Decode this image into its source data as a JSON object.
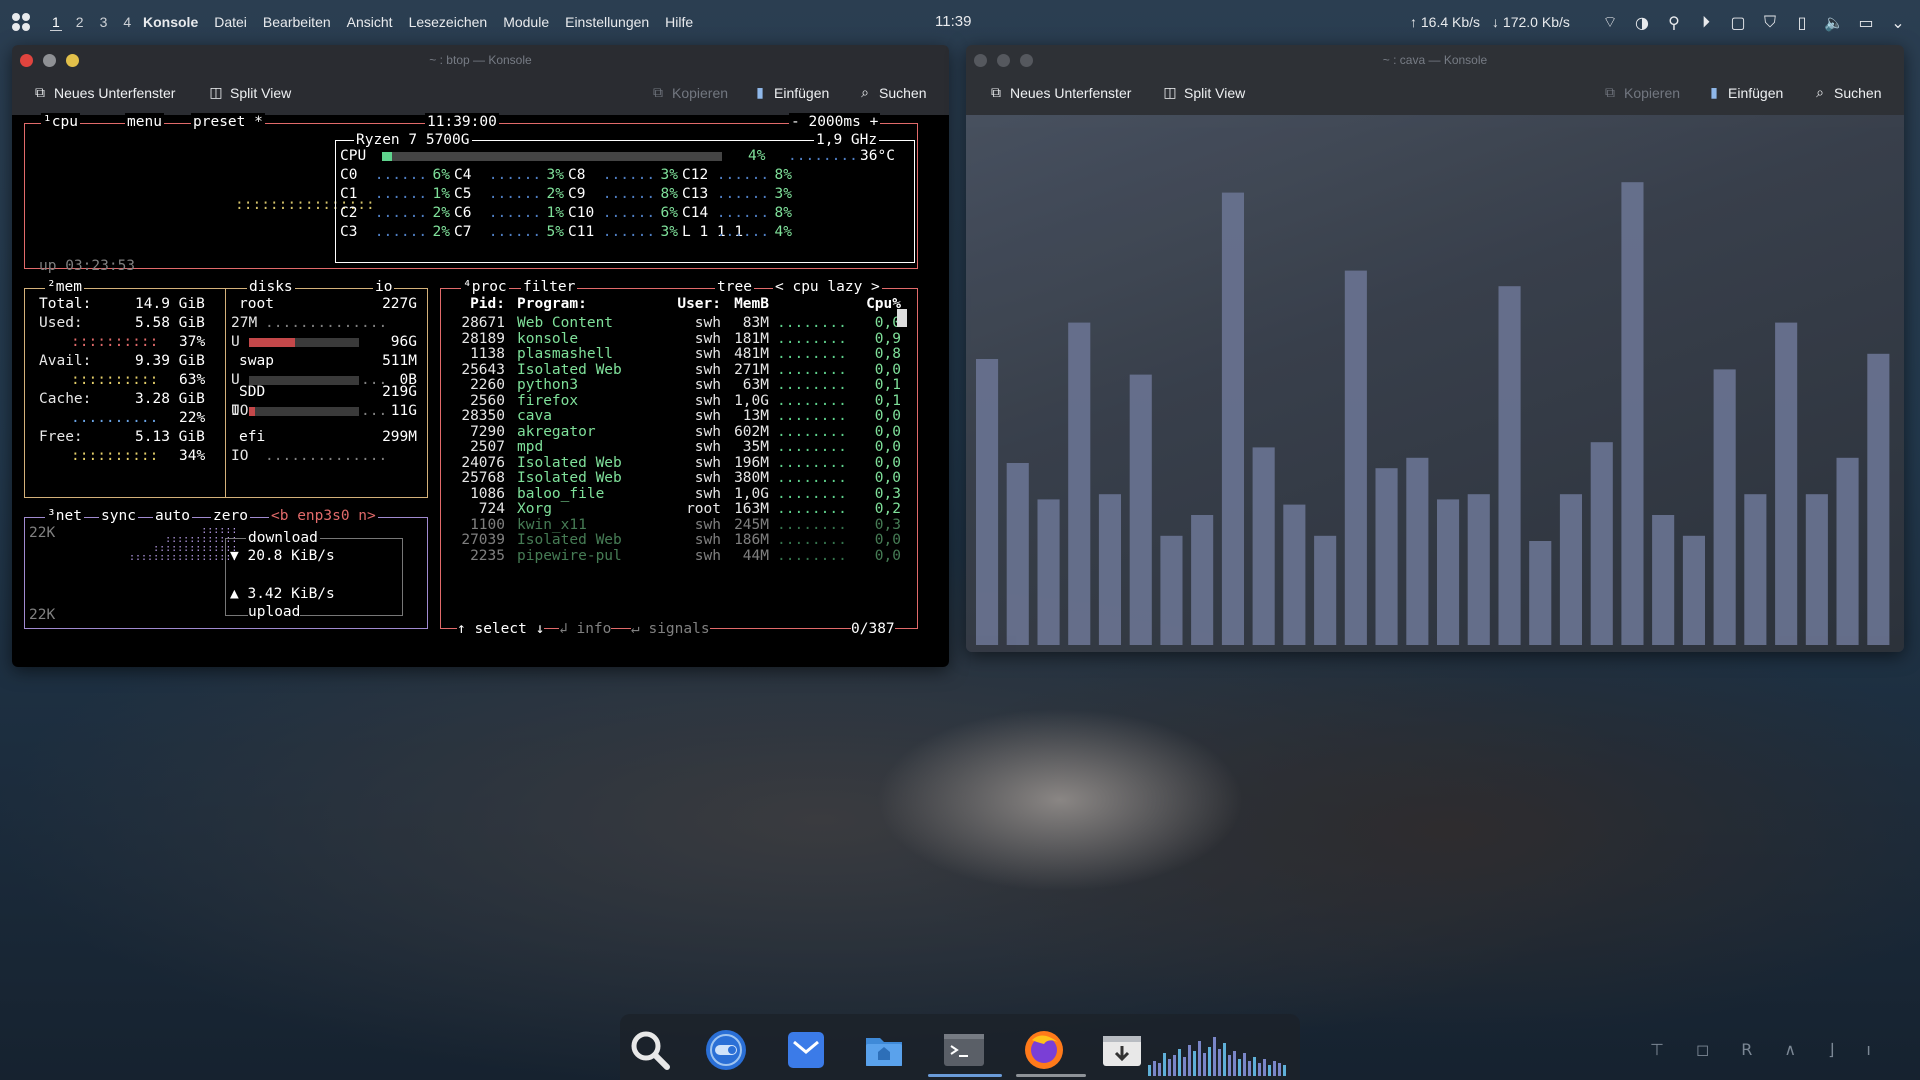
{
  "topbar": {
    "workspaces": [
      "1",
      "2",
      "3",
      "4"
    ],
    "app_name": "Konsole",
    "menu": [
      "Datei",
      "Bearbeiten",
      "Ansicht",
      "Lesezeichen",
      "Module",
      "Einstellungen",
      "Hilfe"
    ],
    "clock": "11:39",
    "net_up": "↑  16.4 Kb/s",
    "net_down": "↓ 172.0 Kb/s",
    "tray_icons": [
      "rss-icon",
      "night-mode-icon",
      "location-icon",
      "media-play-icon",
      "clipboard-icon",
      "shield-icon",
      "battery-icon",
      "volume-icon",
      "display-icon",
      "chevron-down-icon"
    ]
  },
  "btop_window": {
    "title": "~ : btop — Konsole",
    "toolbar": {
      "new_tab": "Neues Unterfenster",
      "split": "Split View",
      "copy": "Kopieren",
      "paste": "Einfügen",
      "search": "Suchen"
    },
    "cpu_box": {
      "tags": [
        "¹cpu",
        "menu",
        "preset *"
      ],
      "time": "11:39:00",
      "interval": "- 2000ms +",
      "model": "Ryzen 7 5700G",
      "freq": "1,9 GHz",
      "cpu_total": "4%",
      "temp": "36°C",
      "uptime": "up 03:23:53",
      "cores": [
        {
          "n": "C0",
          "v": "6%"
        },
        {
          "n": "C4",
          "v": "3%"
        },
        {
          "n": "C8",
          "v": "3%"
        },
        {
          "n": "C12",
          "v": "8%"
        },
        {
          "n": "C1",
          "v": "1%"
        },
        {
          "n": "C5",
          "v": "2%"
        },
        {
          "n": "C9",
          "v": "8%"
        },
        {
          "n": "C13",
          "v": "3%"
        },
        {
          "n": "C2",
          "v": "2%"
        },
        {
          "n": "C6",
          "v": "1%"
        },
        {
          "n": "C10",
          "v": "6%"
        },
        {
          "n": "C14",
          "v": "8%"
        },
        {
          "n": "C3",
          "v": "2%"
        },
        {
          "n": "C7",
          "v": "5%"
        },
        {
          "n": "C11",
          "v": "3%"
        },
        {
          "n": "L 1 1 1",
          "v": "4%"
        }
      ]
    },
    "mem_box": {
      "total_label": "Total:",
      "total": "14.9 GiB",
      "used_label": "Used:",
      "used": "5.58 GiB",
      "used_pct": "37%",
      "avail_label": "Avail:",
      "avail": "9.39 GiB",
      "avail_pct": "63%",
      "cache_label": "Cache:",
      "cache": "3.28 GiB",
      "cache_pct": "22%",
      "free_label": "Free:",
      "free": "5.13 GiB",
      "free_pct": "34%"
    },
    "disks": [
      {
        "name": "root",
        "size": "227G",
        "sub": "27M",
        "used_lbl": "U",
        "used": "96G",
        "used_frac": 0.42
      },
      {
        "name": "swap",
        "size": "511M",
        "sub": "",
        "used_lbl": "U",
        "used": "0B",
        "used_frac": 0.0
      },
      {
        "name": "SDD",
        "size": "219G",
        "sub": "IO",
        "used_lbl": "U",
        "used": "11G",
        "used_frac": 0.05
      },
      {
        "name": "efi",
        "size": "299M",
        "sub": "IO",
        "used_lbl": "",
        "used": "",
        "used_frac": 0
      }
    ],
    "net_box": {
      "tags": [
        "³net",
        "sync",
        "auto",
        "zero",
        "<b enp3s0 n>"
      ],
      "scale_top": "22K",
      "scale_bottom": "22K",
      "download_label": "download",
      "download": "▼ 20.8 KiB/s",
      "upload": "▲ 3.42 KiB/s",
      "upload_label": "upload"
    },
    "proc_box": {
      "tags": [
        "⁴proc",
        "filter",
        "tree",
        "< cpu lazy >"
      ],
      "headers": [
        "Pid:",
        "Program:",
        "User:",
        "MemB",
        "Cpu%"
      ],
      "rows": [
        [
          "28671",
          "Web Content",
          "swh",
          "83M",
          "0,0"
        ],
        [
          "28189",
          "konsole",
          "swh",
          "181M",
          "0,9"
        ],
        [
          "1138",
          "plasmashell",
          "swh",
          "481M",
          "0,8"
        ],
        [
          "25643",
          "Isolated Web",
          "swh",
          "271M",
          "0,0"
        ],
        [
          "2260",
          "python3",
          "swh",
          "63M",
          "0,1"
        ],
        [
          "2560",
          "firefox",
          "swh",
          "1,0G",
          "0,1"
        ],
        [
          "28350",
          "cava",
          "swh",
          "13M",
          "0,0"
        ],
        [
          "7290",
          "akregator",
          "swh",
          "602M",
          "0,0"
        ],
        [
          "2507",
          "mpd",
          "swh",
          "35M",
          "0,0"
        ],
        [
          "24076",
          "Isolated Web",
          "swh",
          "196M",
          "0,0"
        ],
        [
          "25768",
          "Isolated Web",
          "swh",
          "380M",
          "0,0"
        ],
        [
          "1086",
          "baloo_file",
          "swh",
          "1,0G",
          "0,3"
        ],
        [
          "724",
          "Xorg",
          "root",
          "163M",
          "0,2"
        ],
        [
          "1100",
          "kwin_x11",
          "swh",
          "245M",
          "0,3"
        ],
        [
          "27039",
          "Isolated Web",
          "swh",
          "186M",
          "0,0"
        ],
        [
          "2235",
          "pipewire-pul",
          "swh",
          "44M",
          "0,0"
        ]
      ],
      "footer_select": "↑ select ↓",
      "footer_info": "↲ info",
      "footer_signals": "↵ signals",
      "footer_count": "0/387"
    }
  },
  "cava_window": {
    "title": "~ : cava — Konsole",
    "toolbar": {
      "new_tab": "Neues Unterfenster",
      "split": "Split View",
      "copy": "Kopieren",
      "paste": "Einfügen",
      "search": "Suchen"
    },
    "bar_color": "#6a7390",
    "levels": [
      0.55,
      0.35,
      0.28,
      0.62,
      0.29,
      0.52,
      0.21,
      0.25,
      0.87,
      0.38,
      0.27,
      0.21,
      0.72,
      0.34,
      0.36,
      0.28,
      0.29,
      0.69,
      0.2,
      0.29,
      0.39,
      0.89,
      0.25,
      0.21,
      0.53,
      0.29,
      0.62,
      0.29,
      0.36,
      0.56
    ]
  },
  "dock": {
    "items": [
      "search-icon",
      "toggle-icon",
      "mail-icon",
      "files-icon",
      "terminal-icon",
      "firefox-icon",
      "downloads-icon",
      "audio-visualizer-icon"
    ],
    "visualizer": [
      0.2,
      0.3,
      0.25,
      0.5,
      0.35,
      0.45,
      0.6,
      0.4,
      0.7,
      0.55,
      0.8,
      0.5,
      0.65,
      0.9,
      0.6,
      0.75,
      0.45,
      0.55,
      0.35,
      0.5,
      0.3,
      0.4,
      0.25,
      0.35,
      0.2,
      0.3,
      0.25,
      0.2
    ]
  },
  "desktop_corner": [
    "⊤",
    "◻",
    "R",
    "∧",
    "⌋",
    "ı"
  ]
}
